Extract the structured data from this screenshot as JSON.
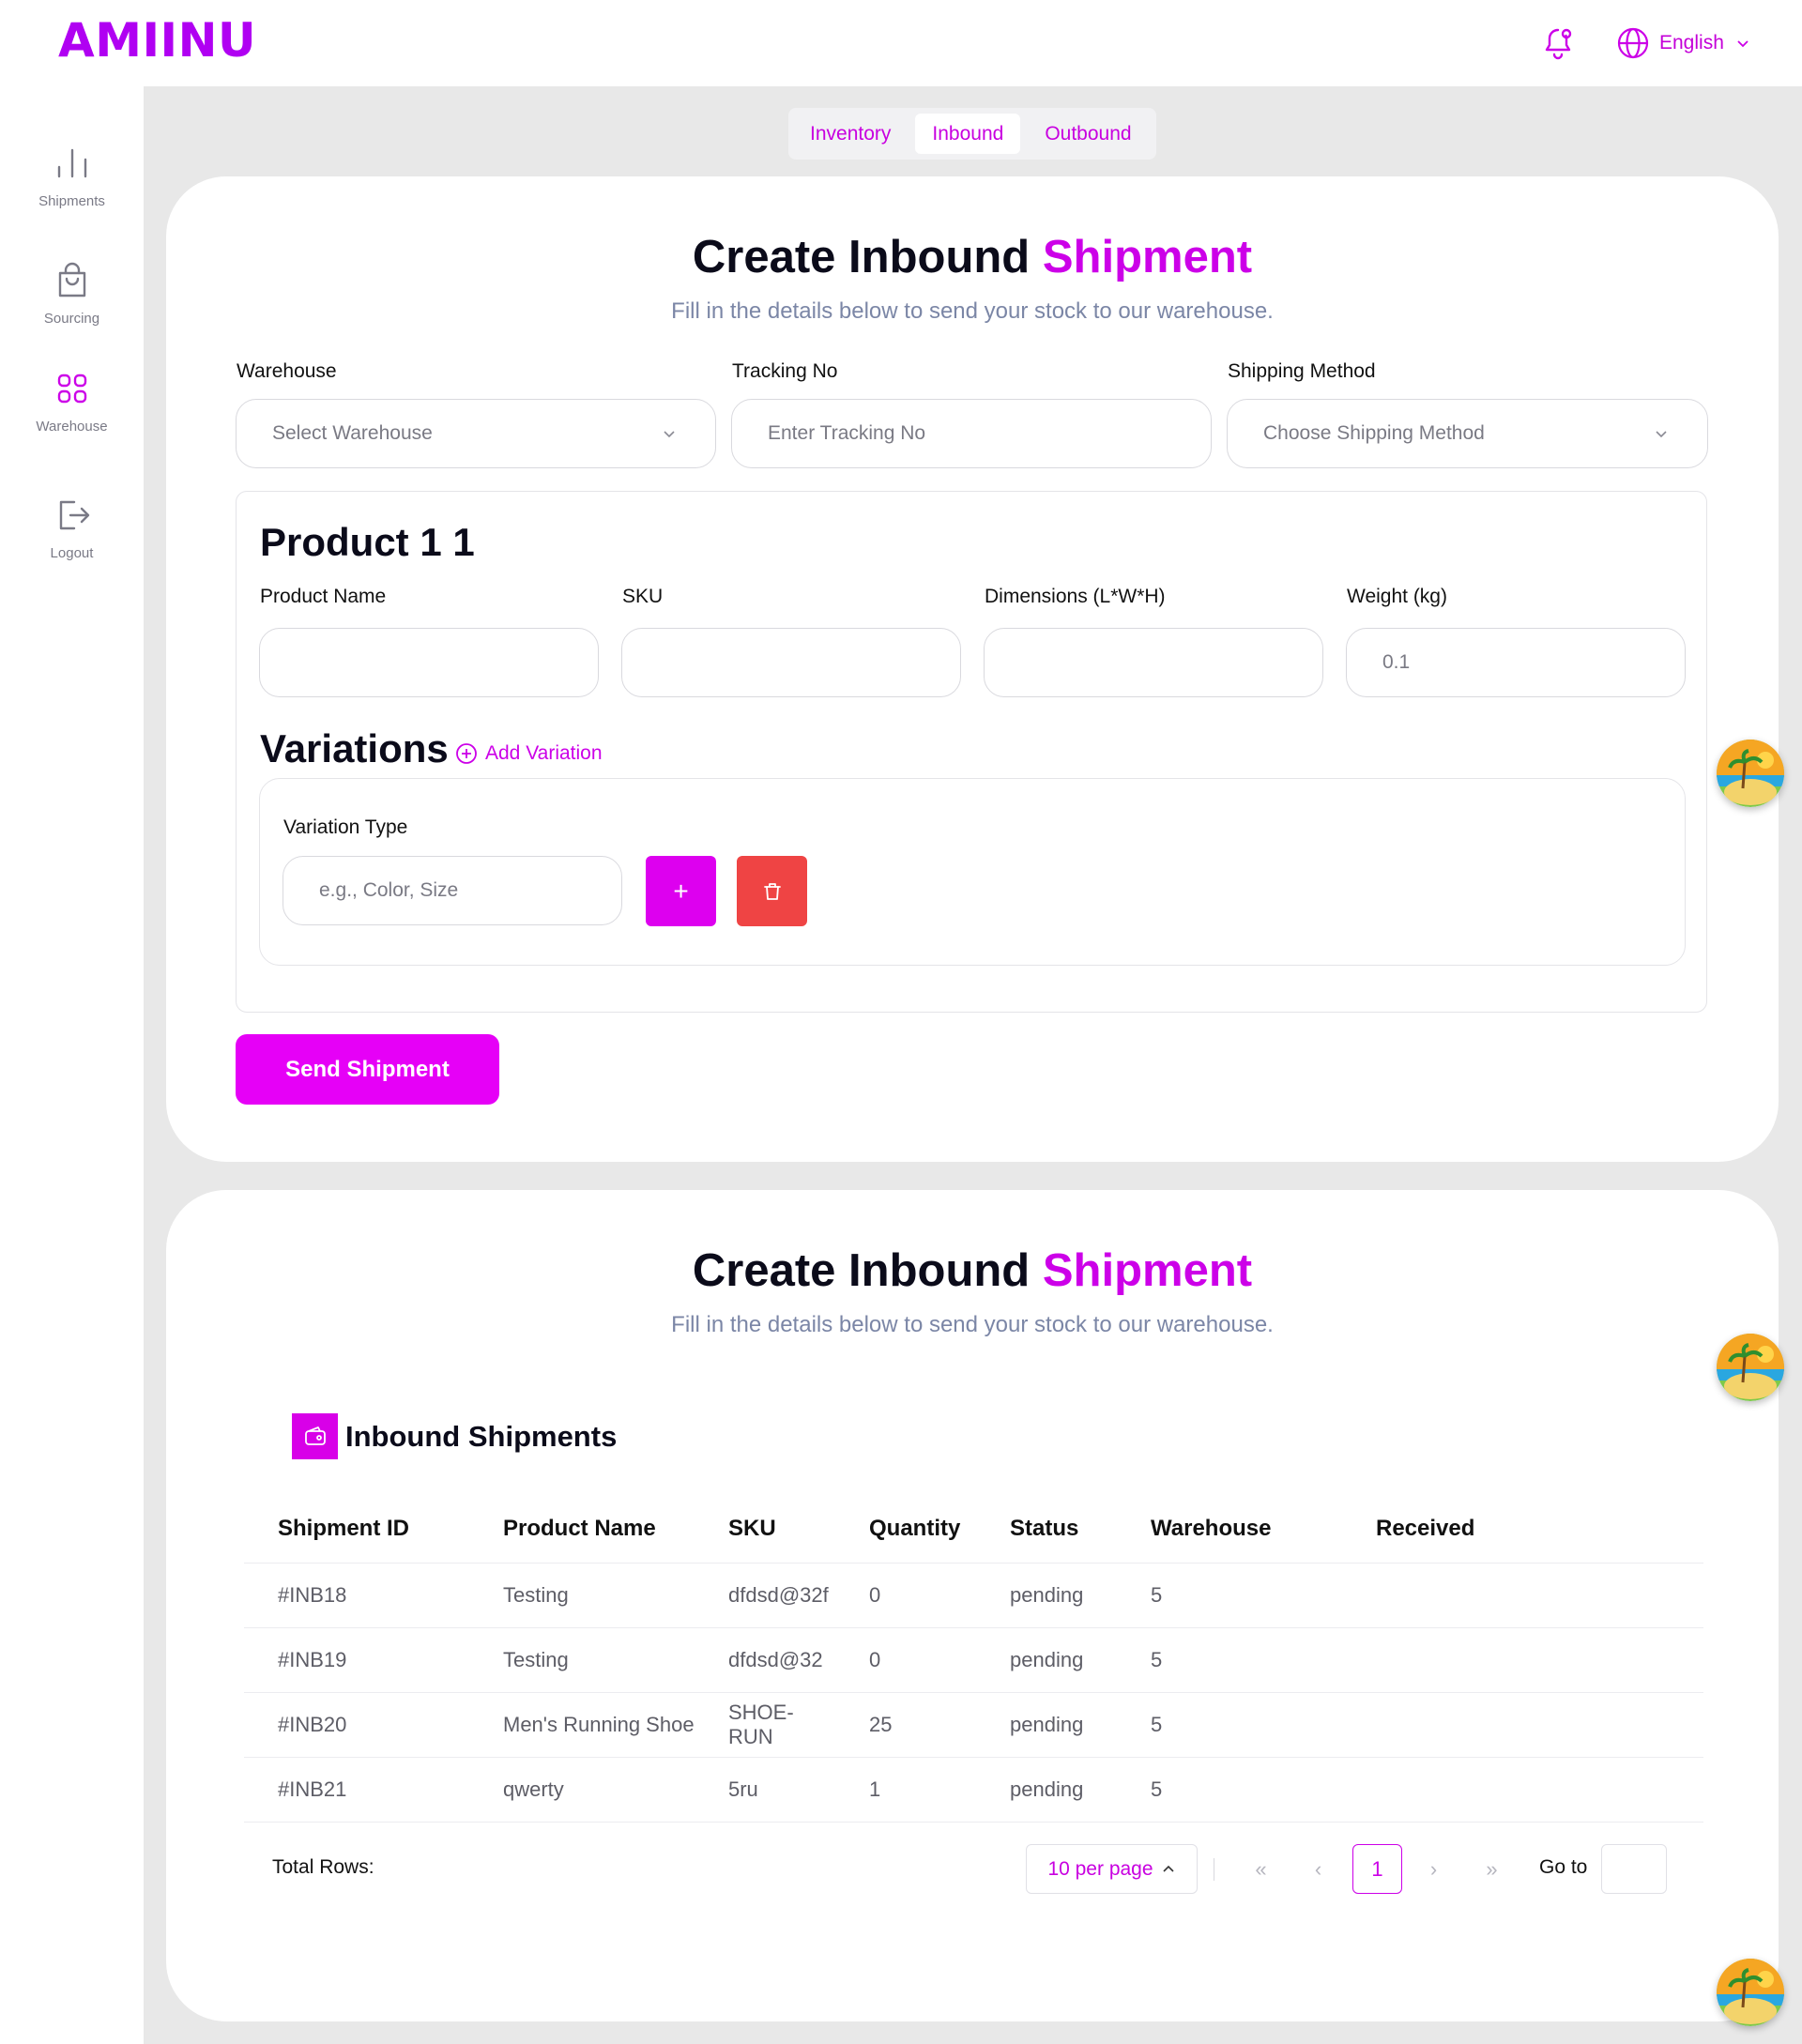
{
  "header": {
    "logo": "AMIINU",
    "language": "English"
  },
  "sidebar": {
    "items": [
      {
        "label": "Shipments",
        "icon": "bar-chart-icon"
      },
      {
        "label": "Sourcing",
        "icon": "shopping-bag-icon"
      },
      {
        "label": "Warehouse",
        "icon": "grid-icon"
      },
      {
        "label": "Logout",
        "icon": "logout-icon"
      }
    ]
  },
  "tabs": [
    {
      "label": "Inventory",
      "active": false
    },
    {
      "label": "Inbound",
      "active": true
    },
    {
      "label": "Outbound",
      "active": false
    }
  ],
  "form": {
    "title": "Create Inbound",
    "title_accent": "Shipment",
    "subtitle": "Fill in the details below to send your stock to our warehouse.",
    "warehouse_label": "Warehouse",
    "warehouse_placeholder": "Select Warehouse",
    "tracking_label": "Tracking No",
    "tracking_placeholder": "Enter Tracking No",
    "shipping_label": "Shipping Method",
    "shipping_placeholder": "Choose Shipping Method",
    "product": {
      "heading": "Product 1 1",
      "name_label": "Product Name",
      "name_value": "",
      "sku_label": "SKU",
      "sku_value": "",
      "dims_label": "Dimensions (L*W*H)",
      "dims_value": "",
      "weight_label": "Weight (kg)",
      "weight_value": "0.1"
    },
    "variations": {
      "heading": "Variations",
      "add_label": "Add Variation",
      "type_label": "Variation Type",
      "type_placeholder": "e.g., Color, Size",
      "plus_label": "+"
    },
    "send_label": "Send Shipment"
  },
  "list": {
    "title": "Create Inbound",
    "title_accent": "Shipment",
    "subtitle": "Fill in the details below to send your stock to our warehouse.",
    "section_title": "Inbound Shipments",
    "columns": [
      "Shipment ID",
      "Product Name",
      "SKU",
      "Quantity",
      "Status",
      "Warehouse",
      "Received"
    ],
    "rows": [
      [
        "#INB18",
        "Testing",
        "dfdsd@32f",
        "0",
        "pending",
        "5",
        ""
      ],
      [
        "#INB19",
        "Testing",
        "dfdsd@32",
        "0",
        "pending",
        "5",
        ""
      ],
      [
        "#INB20",
        "Men's Running Shoe",
        "SHOE-RUN",
        "25",
        "pending",
        "5",
        ""
      ],
      [
        "#INB21",
        "qwerty",
        "5ru",
        "1",
        "pending",
        "5",
        ""
      ]
    ],
    "pager": {
      "total_label": "Total Rows:",
      "per_page": "10 per page",
      "first": "«",
      "prev": "‹",
      "current_page": "1",
      "next": "›",
      "last": "»",
      "goto_label": "Go to"
    }
  },
  "colors": {
    "brand": "#cc00e8",
    "danger": "#ef4444",
    "page_bg": "#e8e8e8"
  }
}
